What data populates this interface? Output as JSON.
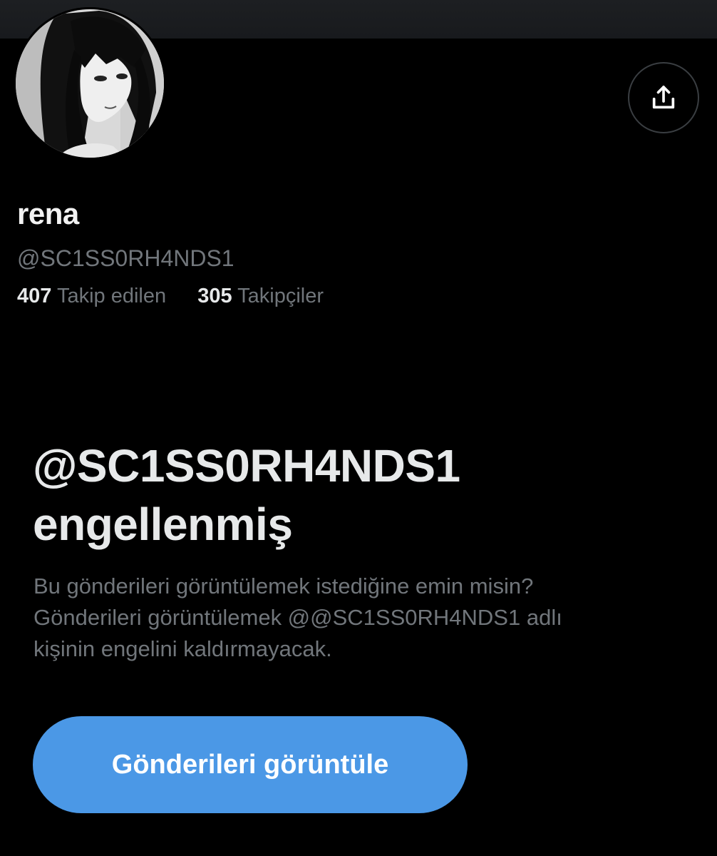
{
  "profile": {
    "display_name": "rena",
    "handle": "@SC1SS0RH4NDS1",
    "following_count": "407",
    "following_label": "Takip edilen",
    "followers_count": "305",
    "followers_label": "Takipçiler",
    "avatar_icon": "avatar-illustration",
    "share_icon": "share-icon"
  },
  "blocked": {
    "title_line1": "@SC1SS0RH4NDS1",
    "title_line2": "engellenmiş",
    "description_line1": "Bu gönderileri görüntülemek istediğine emin misin?",
    "description_line2": "Gönderileri görüntülemek @@SC1SS0RH4NDS1 adlı",
    "description_line3": "kişinin engelini kaldırmayacak.",
    "view_button_label": "Gönderileri görüntüle"
  },
  "colors": {
    "background": "#000000",
    "accent": "#4b98e6",
    "muted_text": "#71767b",
    "primary_text": "#e7e9ea"
  }
}
